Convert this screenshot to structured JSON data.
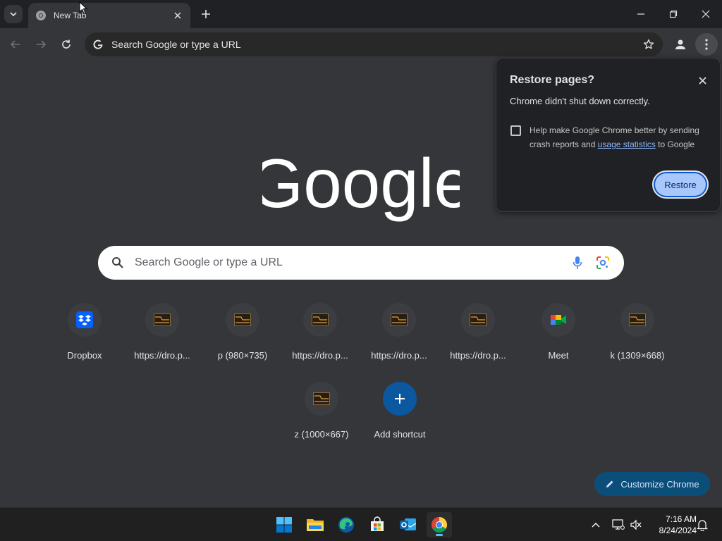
{
  "browser": {
    "tab": {
      "title": "New Tab",
      "close_icon": "close-icon",
      "favicon": "chrome-icon"
    },
    "new_tab_icon": "plus-icon",
    "window_controls": [
      "minimize-icon",
      "restore-icon",
      "close-icon"
    ],
    "omnibox": {
      "placeholder": "Search Google or type a URL"
    }
  },
  "ntp": {
    "logo_text": "Google",
    "search_placeholder": "Search Google or type a URL",
    "shortcuts": [
      {
        "label": "Dropbox",
        "icon": "dropbox-icon"
      },
      {
        "label": "https://dro.p...",
        "icon": "thumbnail-icon"
      },
      {
        "label": "p (980×735)",
        "icon": "thumbnail-icon"
      },
      {
        "label": "https://dro.p...",
        "icon": "thumbnail-icon"
      },
      {
        "label": "https://dro.p...",
        "icon": "thumbnail-icon"
      },
      {
        "label": "https://dro.p...",
        "icon": "thumbnail-icon"
      },
      {
        "label": "Meet",
        "icon": "meet-icon"
      },
      {
        "label": "k (1309×668)",
        "icon": "thumbnail-icon"
      },
      {
        "label": "z (1000×667)",
        "icon": "thumbnail-icon"
      },
      {
        "label": "Add shortcut",
        "icon": "plus-icon"
      }
    ],
    "customize_label": "Customize Chrome"
  },
  "restore_dialog": {
    "title": "Restore pages?",
    "subtitle": "Chrome didn't shut down correctly.",
    "help_text_1": "Help make Google Chrome better by sending crash reports and",
    "help_link": "usage statistics",
    "help_text_2": "to Google",
    "checkbox_checked": false,
    "button_label": "Restore"
  },
  "taskbar": {
    "apps": [
      "windows-start-icon",
      "file-explorer-icon",
      "edge-icon",
      "store-icon",
      "outlook-icon",
      "chrome-icon"
    ],
    "time": "7:16 AM",
    "date": "8/24/2024"
  },
  "colors": {
    "accent": "#a8c7fa",
    "page_bg": "#35363a",
    "frame_bg": "#202124"
  }
}
